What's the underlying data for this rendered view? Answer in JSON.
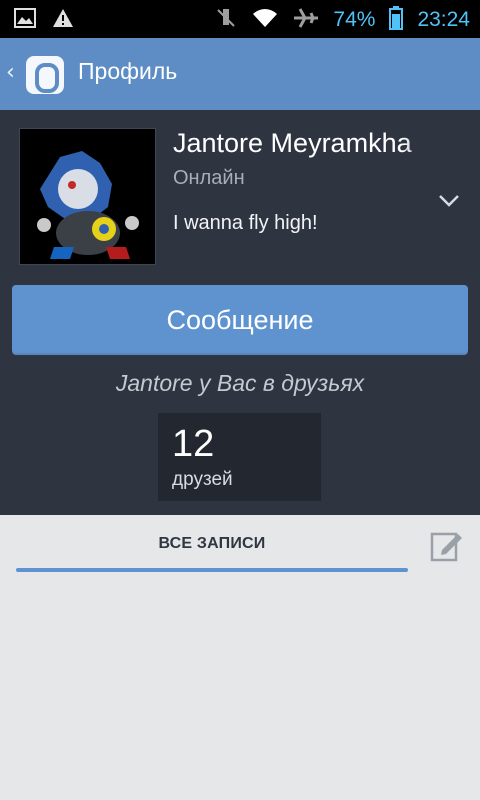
{
  "status_bar": {
    "battery_percent": "74%",
    "time": "23:24",
    "icons": [
      "image-icon",
      "warning-icon",
      "mute-icon",
      "wifi-icon",
      "airplane-icon",
      "battery-icon"
    ]
  },
  "action_bar": {
    "title": "Профиль",
    "icons": [
      "back-chevron-icon",
      "app-icon"
    ]
  },
  "profile": {
    "name": "Jantore Meyramkha",
    "online_status": "Онлайн",
    "status_quote": "I wanna fly high!",
    "message_button_label": "Сообщение",
    "friendship_note": "Jantore у Вас в друзьях",
    "friends_count": "12",
    "friends_label": "друзей"
  },
  "tabs": {
    "active_label": "ВСЕ ЗАПИСИ"
  },
  "colors": {
    "accent": "#5f93cf",
    "header_bg": "#5d8dc4",
    "profile_bg": "#2f3540"
  }
}
